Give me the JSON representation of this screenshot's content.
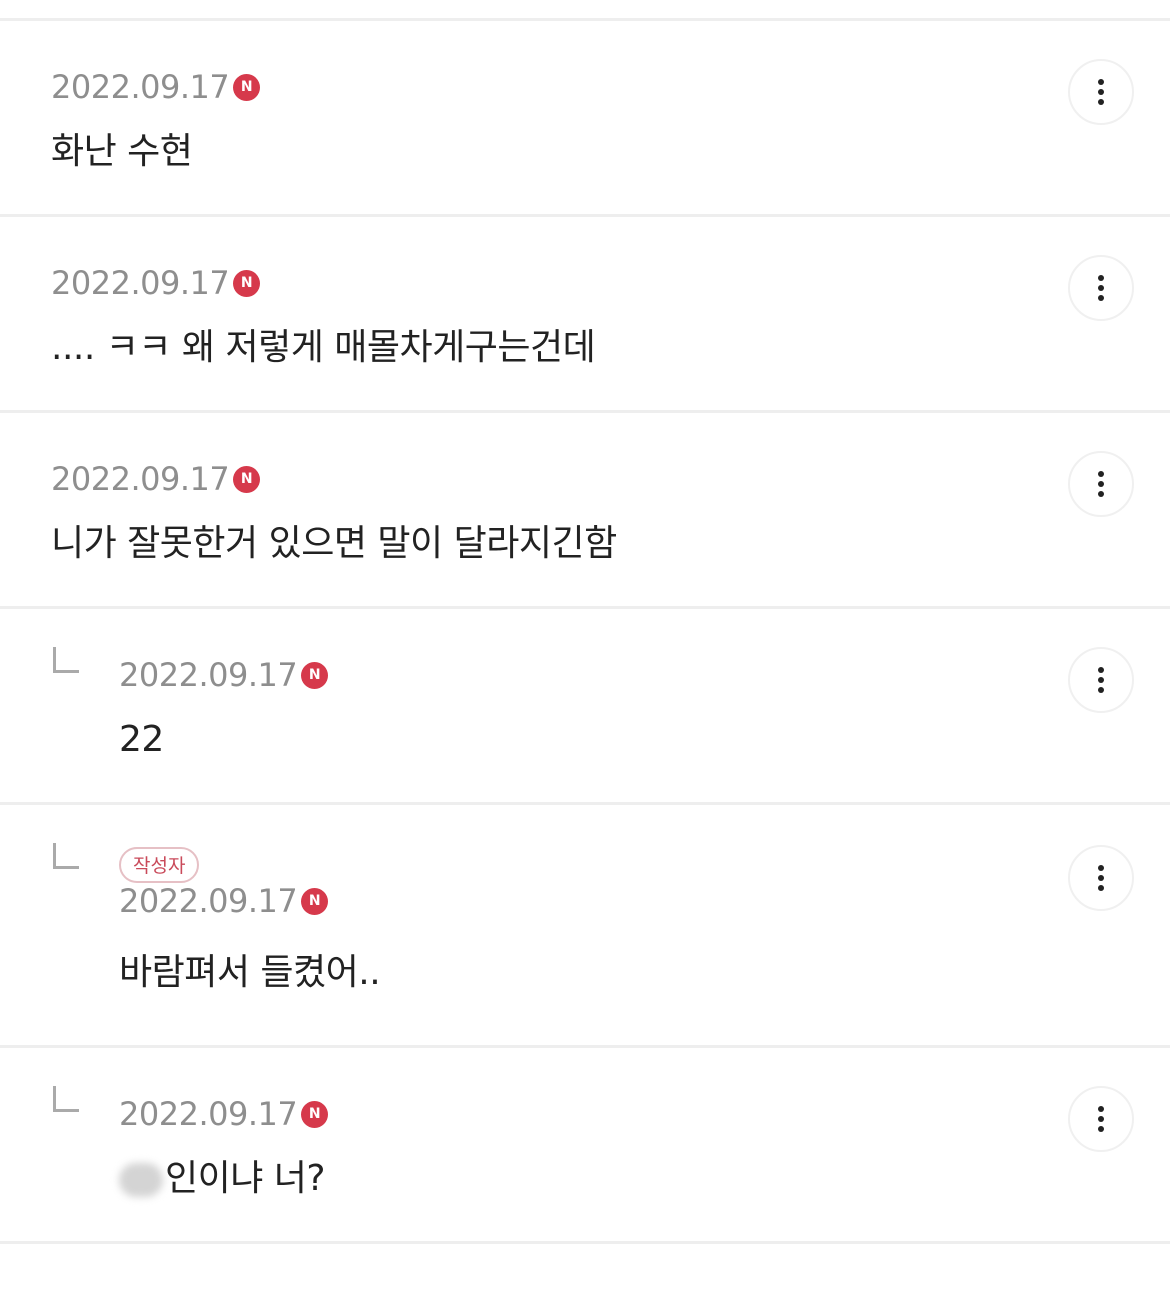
{
  "badge_letter": "N",
  "badge_color": "#d6394b",
  "author_badge_label": "작성자",
  "comments": [
    {
      "date": "2022.09.17",
      "text": "화난 수현",
      "is_reply": false,
      "is_author": false
    },
    {
      "date": "2022.09.17",
      "text": ".... ㅋㅋ 왜 저렇게 매몰차게구는건데",
      "is_reply": false,
      "is_author": false
    },
    {
      "date": "2022.09.17",
      "text": "니가 잘못한거 있으면 말이 달라지긴함",
      "is_reply": false,
      "is_author": false
    },
    {
      "date": "2022.09.17",
      "text": "22",
      "is_reply": true,
      "is_author": false
    },
    {
      "date": "2022.09.17",
      "text": "바람펴서 들켰어..",
      "is_reply": true,
      "is_author": true
    },
    {
      "date": "2022.09.17",
      "text": "인이냐 너?",
      "text_has_obscured_prefix": true,
      "is_reply": true,
      "is_author": false
    }
  ],
  "icons": {
    "more": "more-vertical-icon",
    "reply": "reply-corner-icon",
    "badge": "naver-n-badge-icon"
  }
}
